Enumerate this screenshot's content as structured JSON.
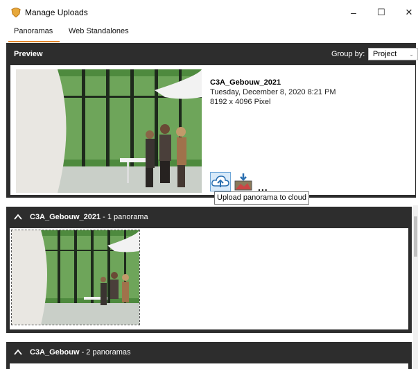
{
  "window": {
    "title": "Manage Uploads",
    "minimize_glyph": "–",
    "maximize_glyph": "☐",
    "close_glyph": "✕",
    "icon": "shield-icon"
  },
  "tabs": [
    {
      "label": "Panoramas",
      "active": true
    },
    {
      "label": "Web Standalones",
      "active": false
    }
  ],
  "accent_color": "#e3862d",
  "preview": {
    "title": "Preview",
    "group_by_label": "Group by:",
    "group_by_value": "Project",
    "panorama": {
      "name": "C3A_Gebouw_2021",
      "date": "Tuesday, December 8, 2020 8:21 PM",
      "size": "8192 x 4096  Pixel"
    },
    "actions": {
      "upload_icon": "cloud-upload-icon",
      "download_icon": "download-icon",
      "more": "..."
    },
    "tooltip": "Upload panorama to cloud"
  },
  "groups": [
    {
      "name": "C3A_Gebouw_2021",
      "count": " - 1 panorama"
    },
    {
      "name": "C3A_Gebouw",
      "count": " - 2 panoramas"
    }
  ]
}
